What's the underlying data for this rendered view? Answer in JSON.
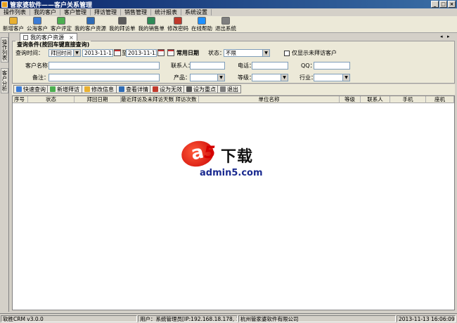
{
  "window": {
    "title": "管家婆软件——客户关系管理",
    "min": "_",
    "max": "□",
    "close": "×"
  },
  "menu": [
    "操作列表",
    "我的客户",
    "客户管理",
    "拜访管理",
    "销售管理",
    "统计报表",
    "系统设置"
  ],
  "toolbar": [
    {
      "label": "新增客户",
      "color": "#e8b030"
    },
    {
      "label": "公海客户",
      "color": "#3a7bd5"
    },
    {
      "label": "客户评定",
      "color": "#4caf50"
    },
    {
      "label": "我的客户资源",
      "color": "#2e6bb5"
    },
    {
      "label": "我的拜访单",
      "color": "#5a5a5a"
    },
    {
      "label": "我的销售单",
      "color": "#2e8b57"
    },
    {
      "label": "修改密码",
      "color": "#c0392b"
    },
    {
      "label": "在线帮助",
      "color": "#1e90ff"
    },
    {
      "label": "退出系统",
      "color": "#7f7f7f"
    }
  ],
  "left_tabs": [
    "操作列表",
    "客户分析"
  ],
  "doc_tab": {
    "label": "我的客户资源",
    "close": "×"
  },
  "query": {
    "legend": "查询条件(按回车键直接查询)",
    "query_time_label": "查询时间：",
    "query_time_value": "拜回时间",
    "date_from": "2013-11-13",
    "to_label": "至",
    "date_to": "2013-11-13",
    "common_date_label": "常用日期",
    "status_label": "状态：",
    "status_value": "不限",
    "only_unvisited_label": "仅显示未拜访客户",
    "customer_name_label": "客户名称：",
    "contact_label": "联系人：",
    "phone_label": "电话：",
    "qq_label": "QQ：",
    "remark_label": "备注：",
    "product_label": "产品：",
    "grade_label": "等级：",
    "industry_label": "行业："
  },
  "actions": [
    {
      "label": "快速查询",
      "color": "#3a7bd5"
    },
    {
      "label": "新增拜访",
      "color": "#4caf50"
    },
    {
      "label": "修改信息",
      "color": "#e8b030"
    },
    {
      "label": "查看详情",
      "color": "#2e6bb5"
    },
    {
      "label": "设为无效",
      "color": "#c0392b"
    },
    {
      "label": "设为重点",
      "color": "#555555"
    },
    {
      "label": "退出",
      "color": "#7f7f7f"
    }
  ],
  "grid_columns": [
    "序号",
    "状态",
    "拜回日期",
    "最近拜访及未拜访天数",
    "拜访次数",
    "单位名称",
    "等级",
    "联系人",
    "手机",
    "座机"
  ],
  "watermark": {
    "a": "a",
    "five": "5",
    "cn": "下载",
    "url": "admin5.com"
  },
  "status": {
    "version": "软胜CRM v3.0.0",
    "user": "用户：系统管理员[IP:192.168.18.178, 192.168.1.",
    "company": "杭州管家婆软件有限公司",
    "datetime": "2013-11-13 16:06:09"
  }
}
